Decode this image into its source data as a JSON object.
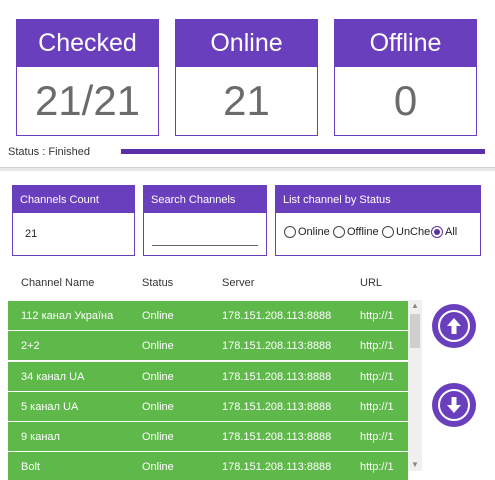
{
  "stats": [
    {
      "label": "Checked",
      "value": "21/21"
    },
    {
      "label": "Online",
      "value": "21"
    },
    {
      "label": "Offline",
      "value": "0"
    }
  ],
  "status_text": "Status : Finished",
  "progress_fraction": 1.0,
  "controls": {
    "channels_count_label": "Channels Count",
    "channels_count_value": "21",
    "search_label": "Search Channels",
    "search_value": "",
    "filter_label": "List channel by Status",
    "filter_options": [
      "Online",
      "Offline",
      "UnChe",
      "All"
    ],
    "filter_selected": "All"
  },
  "table": {
    "headers": [
      "Channel Name",
      "Status",
      "Server",
      "URL"
    ],
    "rows": [
      [
        "112 канал Україна",
        "Online",
        "178.151.208.113:8888",
        "http://1"
      ],
      [
        "2+2",
        "Online",
        "178.151.208.113:8888",
        "http://1"
      ],
      [
        "34 канал UA",
        "Online",
        "178.151.208.113:8888",
        "http://1"
      ],
      [
        "5 канал UA",
        "Online",
        "178.151.208.113:8888",
        "http://1"
      ],
      [
        "9 канал",
        "Online",
        "178.151.208.113:8888",
        "http://1"
      ],
      [
        "Bolt",
        "Online",
        "178.151.208.113:8888",
        "http://1"
      ]
    ]
  },
  "icons": {
    "scroll_up": "arrow-up-circle-icon",
    "scroll_down": "arrow-down-circle-icon"
  },
  "colors": {
    "accent": "#6a3fbd",
    "row_online": "#5fb84a"
  }
}
